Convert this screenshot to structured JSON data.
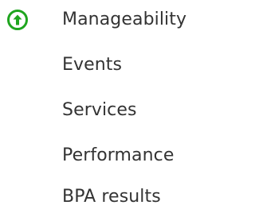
{
  "colors": {
    "status_ok": "#1fa51f",
    "text": "#333333",
    "background": "#ffffff"
  },
  "items": [
    {
      "label": "Manageability",
      "icon": "up-arrow-circle-icon"
    },
    {
      "label": "Events"
    },
    {
      "label": "Services"
    },
    {
      "label": "Performance"
    },
    {
      "label": "BPA results"
    }
  ]
}
